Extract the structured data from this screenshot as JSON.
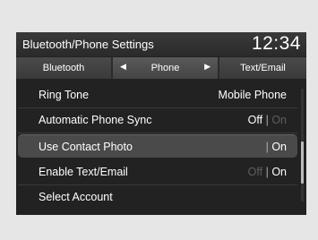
{
  "header": {
    "title": "Bluetooth/Phone Settings",
    "clock": "12:34"
  },
  "tabs": {
    "left_label": "Bluetooth",
    "current_label": "Phone",
    "right_label": "Text/Email",
    "prev_arrow": "◀",
    "next_arrow": "▶"
  },
  "settings": {
    "ring_tone": {
      "label": "Ring Tone",
      "value": "Mobile Phone"
    },
    "auto_sync": {
      "label": "Automatic Phone Sync",
      "off": "Off",
      "sep": "|",
      "on": "On",
      "selected": "Off"
    },
    "contact_photo": {
      "label": "Use Contact Photo",
      "sep": "|",
      "on": "On",
      "selected": "On"
    },
    "text_email": {
      "label": "Enable Text/Email",
      "off": "Off",
      "sep": "|",
      "on": "On",
      "selected": "On"
    },
    "select_account": {
      "label": "Select Account"
    }
  },
  "colors": {
    "screen_bg": "#222222",
    "highlight_bg": "#4a4a4a",
    "dim_text": "#5e5e5e",
    "text": "#ffffff"
  },
  "scrollbar": {
    "position_fraction": 0.47
  }
}
